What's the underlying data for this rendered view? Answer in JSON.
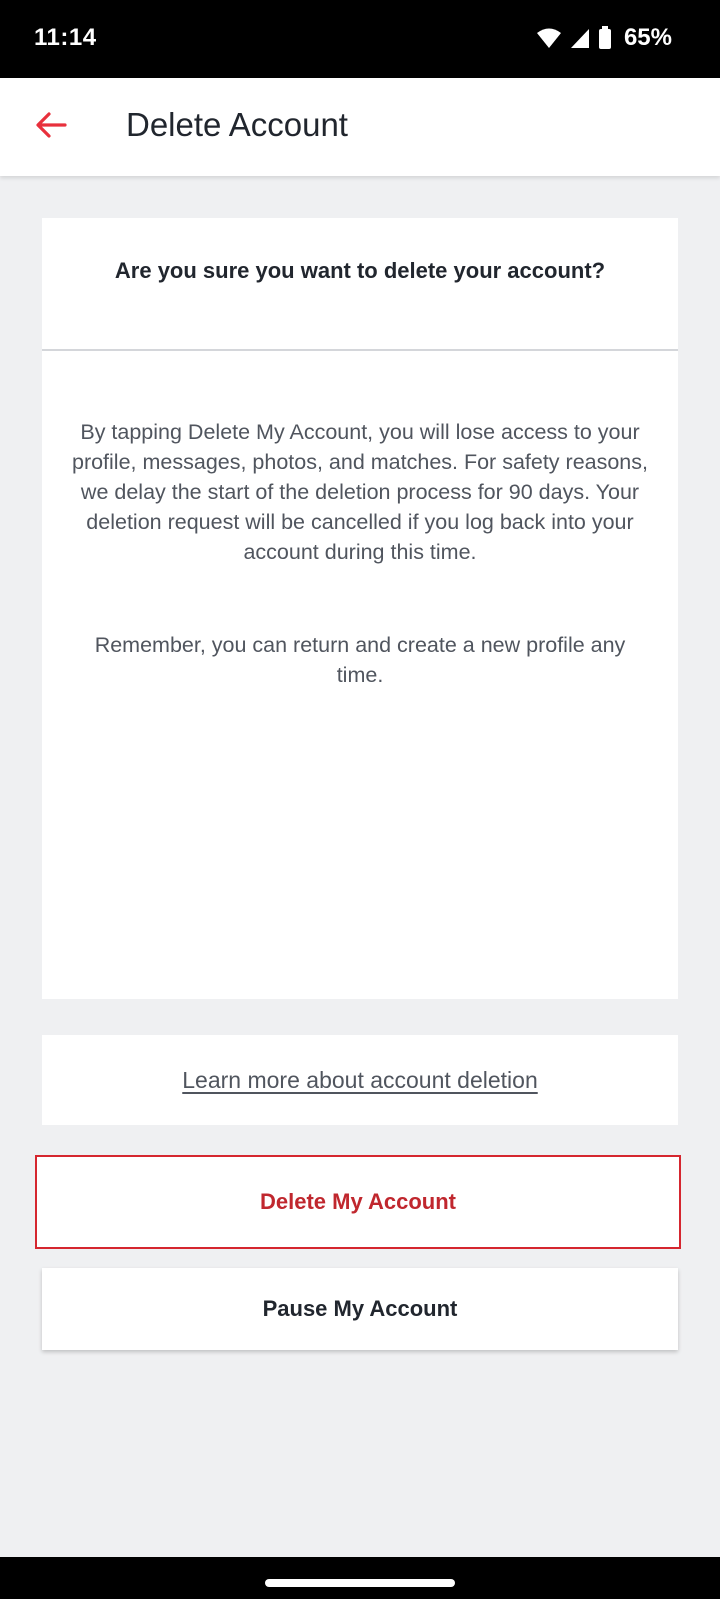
{
  "status_bar": {
    "time": "11:14",
    "battery_percent": "65%",
    "icons": [
      "wifi-icon",
      "cellular-signal-icon",
      "battery-icon"
    ]
  },
  "header": {
    "back_icon": "arrow-left-icon",
    "title": "Delete Account"
  },
  "confirmation": {
    "question": "Are you sure you want to delete your account?",
    "paragraphs": [
      "By tapping Delete My Account, you will lose access to your profile, messages, photos, and matches. For safety reasons, we delay the start of the deletion process for 90 days. Your deletion request will be cancelled if you log back into your account during this time.",
      "Remember, you can return and create a new profile any time."
    ]
  },
  "learn_more": {
    "link_text": "Learn more about account deletion"
  },
  "actions": {
    "delete_label": "Delete My Account",
    "pause_label": "Pause My Account"
  },
  "colors": {
    "accent": "#e8303c",
    "delete_text": "#c0272e",
    "background": "#eff0f2",
    "card": "#ffffff",
    "text_dark": "#21262e",
    "text_muted": "#50555e"
  }
}
